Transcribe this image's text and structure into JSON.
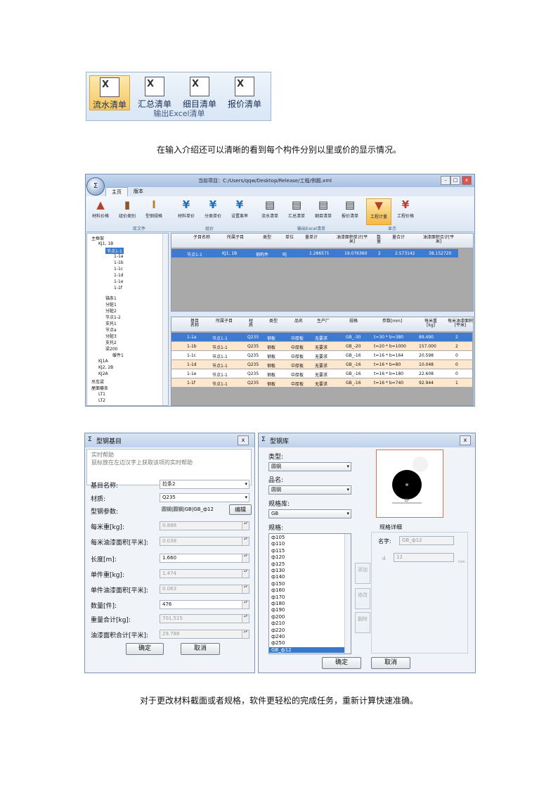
{
  "excel_ribbon": {
    "buttons": [
      "流水清单",
      "汇总清单",
      "细目清单",
      "报价清单"
    ],
    "group_label": "输出Excel清单"
  },
  "caption1": "在输入介绍还可以清晰的看到每个构件分别以里或价的显示情况。",
  "main_window": {
    "title": "当前项目：C:/Users/qqw/Desktop/Release/工程/例题.xml",
    "tabs": [
      "主页",
      "版本"
    ],
    "ribbon_buttons": [
      "材料价格",
      "组价类别",
      "型钢规格",
      "材料单价",
      "分类单价",
      "设置离率",
      "流水清单",
      "汇总清单",
      "细目清单",
      "报价清单",
      "工程计量",
      "工程价格"
    ],
    "group_labels": [
      "库文件",
      "组价",
      "输出Excel清单",
      "显示"
    ],
    "tree": {
      "items": [
        "主框架",
        "KJ1, 1B",
        "节点1-1",
        "1-1a",
        "1-1b",
        "1-1c",
        "1-1d",
        "1-1e",
        "1-1f",
        "锚条1",
        "分脏1",
        "分脏2",
        "节点1-2",
        "支托1",
        "节点a",
        "分脏3",
        "支托2",
        "梁200",
        "缓件1",
        "KJ1A",
        "KJ2, 2B",
        "KJ2A",
        "吊车梁",
        "屋面檩条",
        "LT1",
        "LT2"
      ]
    },
    "grid1": {
      "headers": [
        "子目名称",
        "所属子目",
        "类型",
        "单位",
        "量单计",
        "油漆面积单计[平米]",
        "数量",
        "量合计",
        "油漆面积合计[平米]"
      ],
      "rows": [
        [
          "节点1-1",
          "KJ1, 1B",
          "钢构件",
          "吨",
          "1.286571",
          "19.076360",
          "2",
          "2.573142",
          "38.152720"
        ]
      ]
    },
    "grid2": {
      "headers": [
        "基目名称",
        "所属子目",
        "材质",
        "类型",
        "品名",
        "生产厂",
        "规格",
        "参数[mm]",
        "每米重[kg]",
        "每米油漆面积[平米]"
      ],
      "rows": [
        [
          "1-1a",
          "节点1-1",
          "Q235",
          "钢板",
          "中厚板",
          "无要求",
          "GB_-30",
          "t=30 * b=380",
          "89.490",
          "2"
        ],
        [
          "1-1b",
          "节点1-1",
          "Q235",
          "钢板",
          "中厚板",
          "无要求",
          "GB_-20",
          "t=20 * b=1000",
          "157.000",
          "2"
        ],
        [
          "1-1c",
          "节点1-1",
          "Q235",
          "钢板",
          "中厚板",
          "无要求",
          "GB_-16",
          "t=16 * b=164",
          "20.598",
          "0"
        ],
        [
          "1-1d",
          "节点1-1",
          "Q235",
          "钢板",
          "中厚板",
          "无要求",
          "GB_-16",
          "t=16 * b=80",
          "10.048",
          "0"
        ],
        [
          "1-1e",
          "节点1-1",
          "Q235",
          "钢板",
          "中厚板",
          "无要求",
          "GB_-16",
          "t=16 * b=180",
          "22.608",
          "0"
        ],
        [
          "1-1f",
          "节点1-1",
          "Q235",
          "钢板",
          "中厚板",
          "无要求",
          "GB_-16",
          "t=16 * b=740",
          "92.944",
          "1"
        ]
      ]
    }
  },
  "dialog_base": {
    "title": "型钢基目",
    "help_title": "实时帮助",
    "help_text": "鼠标放在左边汉字上获取该项的实时帮助",
    "fields": [
      {
        "label": "基目名称:",
        "value": "拉条2"
      },
      {
        "label": "材质:",
        "value": "Q235"
      },
      {
        "label": "型钢参数:",
        "value": "圆钢|圆钢|GB|GB_ф12"
      },
      {
        "label": "每米重[kg]:",
        "value": "0.888"
      },
      {
        "label": "每米油漆面积[平米]:",
        "value": "0.038"
      },
      {
        "label": "长度[m]:",
        "value": "1.660"
      },
      {
        "label": "单件重[kg]:",
        "value": "1.474"
      },
      {
        "label": "单件油漆面积[平米]:",
        "value": "0.063"
      },
      {
        "label": "数量[件]:",
        "value": "476"
      },
      {
        "label": "重量合计[kg]:",
        "value": "701.515"
      },
      {
        "label": "油漆面积合计[平米]:",
        "value": "29.788"
      }
    ],
    "edit_button": "编辑",
    "ok_button": "确定",
    "cancel_button": "取消"
  },
  "dialog_lib": {
    "title": "型钢库",
    "type_label": "类型:",
    "type_value": "圆钢",
    "name_label": "品名:",
    "name_value": "圆钢",
    "lib_label": "规格库:",
    "lib_value": "GB",
    "spec_label": "规格:",
    "specs": [
      "ф105",
      "ф110",
      "ф115",
      "ф120",
      "ф125",
      "ф130",
      "ф140",
      "ф150",
      "ф160",
      "ф170",
      "ф180",
      "ф190",
      "ф200",
      "ф210",
      "ф220",
      "ф240",
      "ф250",
      "GB_ф12"
    ],
    "side_buttons": [
      "添加",
      "修改",
      "删除"
    ],
    "detail_title": "规格详细",
    "name_field_label": "名字:",
    "name_field_value": "GB_ф12",
    "d_label": "d",
    "d_value": "12",
    "d_unit": "mm",
    "preview_dim": "D",
    "ok_button": "确定",
    "cancel_button": "取消"
  },
  "caption2": "对于更改材料截面或者规格，软件更轻松的完成任务，重新计算快速准确。"
}
